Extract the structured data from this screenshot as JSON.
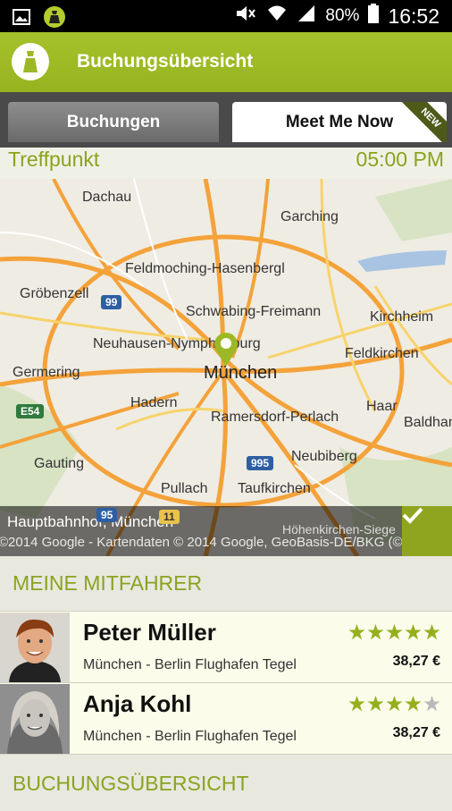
{
  "status_bar": {
    "battery": "80%",
    "time": "16:52",
    "icons": [
      "image-icon",
      "app-notification-icon",
      "mute-icon",
      "wifi-icon",
      "signal-icon",
      "battery-icon"
    ]
  },
  "app_bar": {
    "title": "Buchungsübersicht",
    "accent": "#9db826"
  },
  "tabs": [
    {
      "label": "Buchungen",
      "active": false
    },
    {
      "label": "Meet Me Now",
      "active": true,
      "badge": "NEW"
    }
  ],
  "meeting": {
    "label": "Treffpunkt",
    "time": "05:00 PM"
  },
  "map": {
    "places": [
      "Dachau",
      "Garching",
      "Feldmoching-Hasenbergl",
      "Gröbenzell",
      "Schwabing-Freimann",
      "Kirchheim",
      "Neuhausen-Nymphenburg",
      "München",
      "Feldkirchen",
      "Germering",
      "Hadern",
      "Haar",
      "Ramersdorf-Perlach",
      "Baldham",
      "Neubiberg",
      "Gauting",
      "Pullach",
      "Taufkirchen",
      "Höhenkirchen-Siege"
    ],
    "shields": [
      "99",
      "E54",
      "995",
      "95",
      "11"
    ],
    "address": "Hauptbahnhof, München",
    "copyright": "©2014 Google - Kartendaten © 2014 Google, GeoBasis-DE/BKG (©"
  },
  "riders_section": {
    "title": "MEINE MITFAHRER",
    "riders": [
      {
        "name": "Peter Müller",
        "route": "München - Berlin Flughafen Tegel",
        "price": "38,27 €",
        "rating": 5
      },
      {
        "name": "Anja Kohl",
        "route": "München - Berlin Flughafen Tegel",
        "price": "38,27 €",
        "rating": 4
      }
    ]
  },
  "overview_section": {
    "title": "BUCHUNGSÜBERSICHT"
  }
}
